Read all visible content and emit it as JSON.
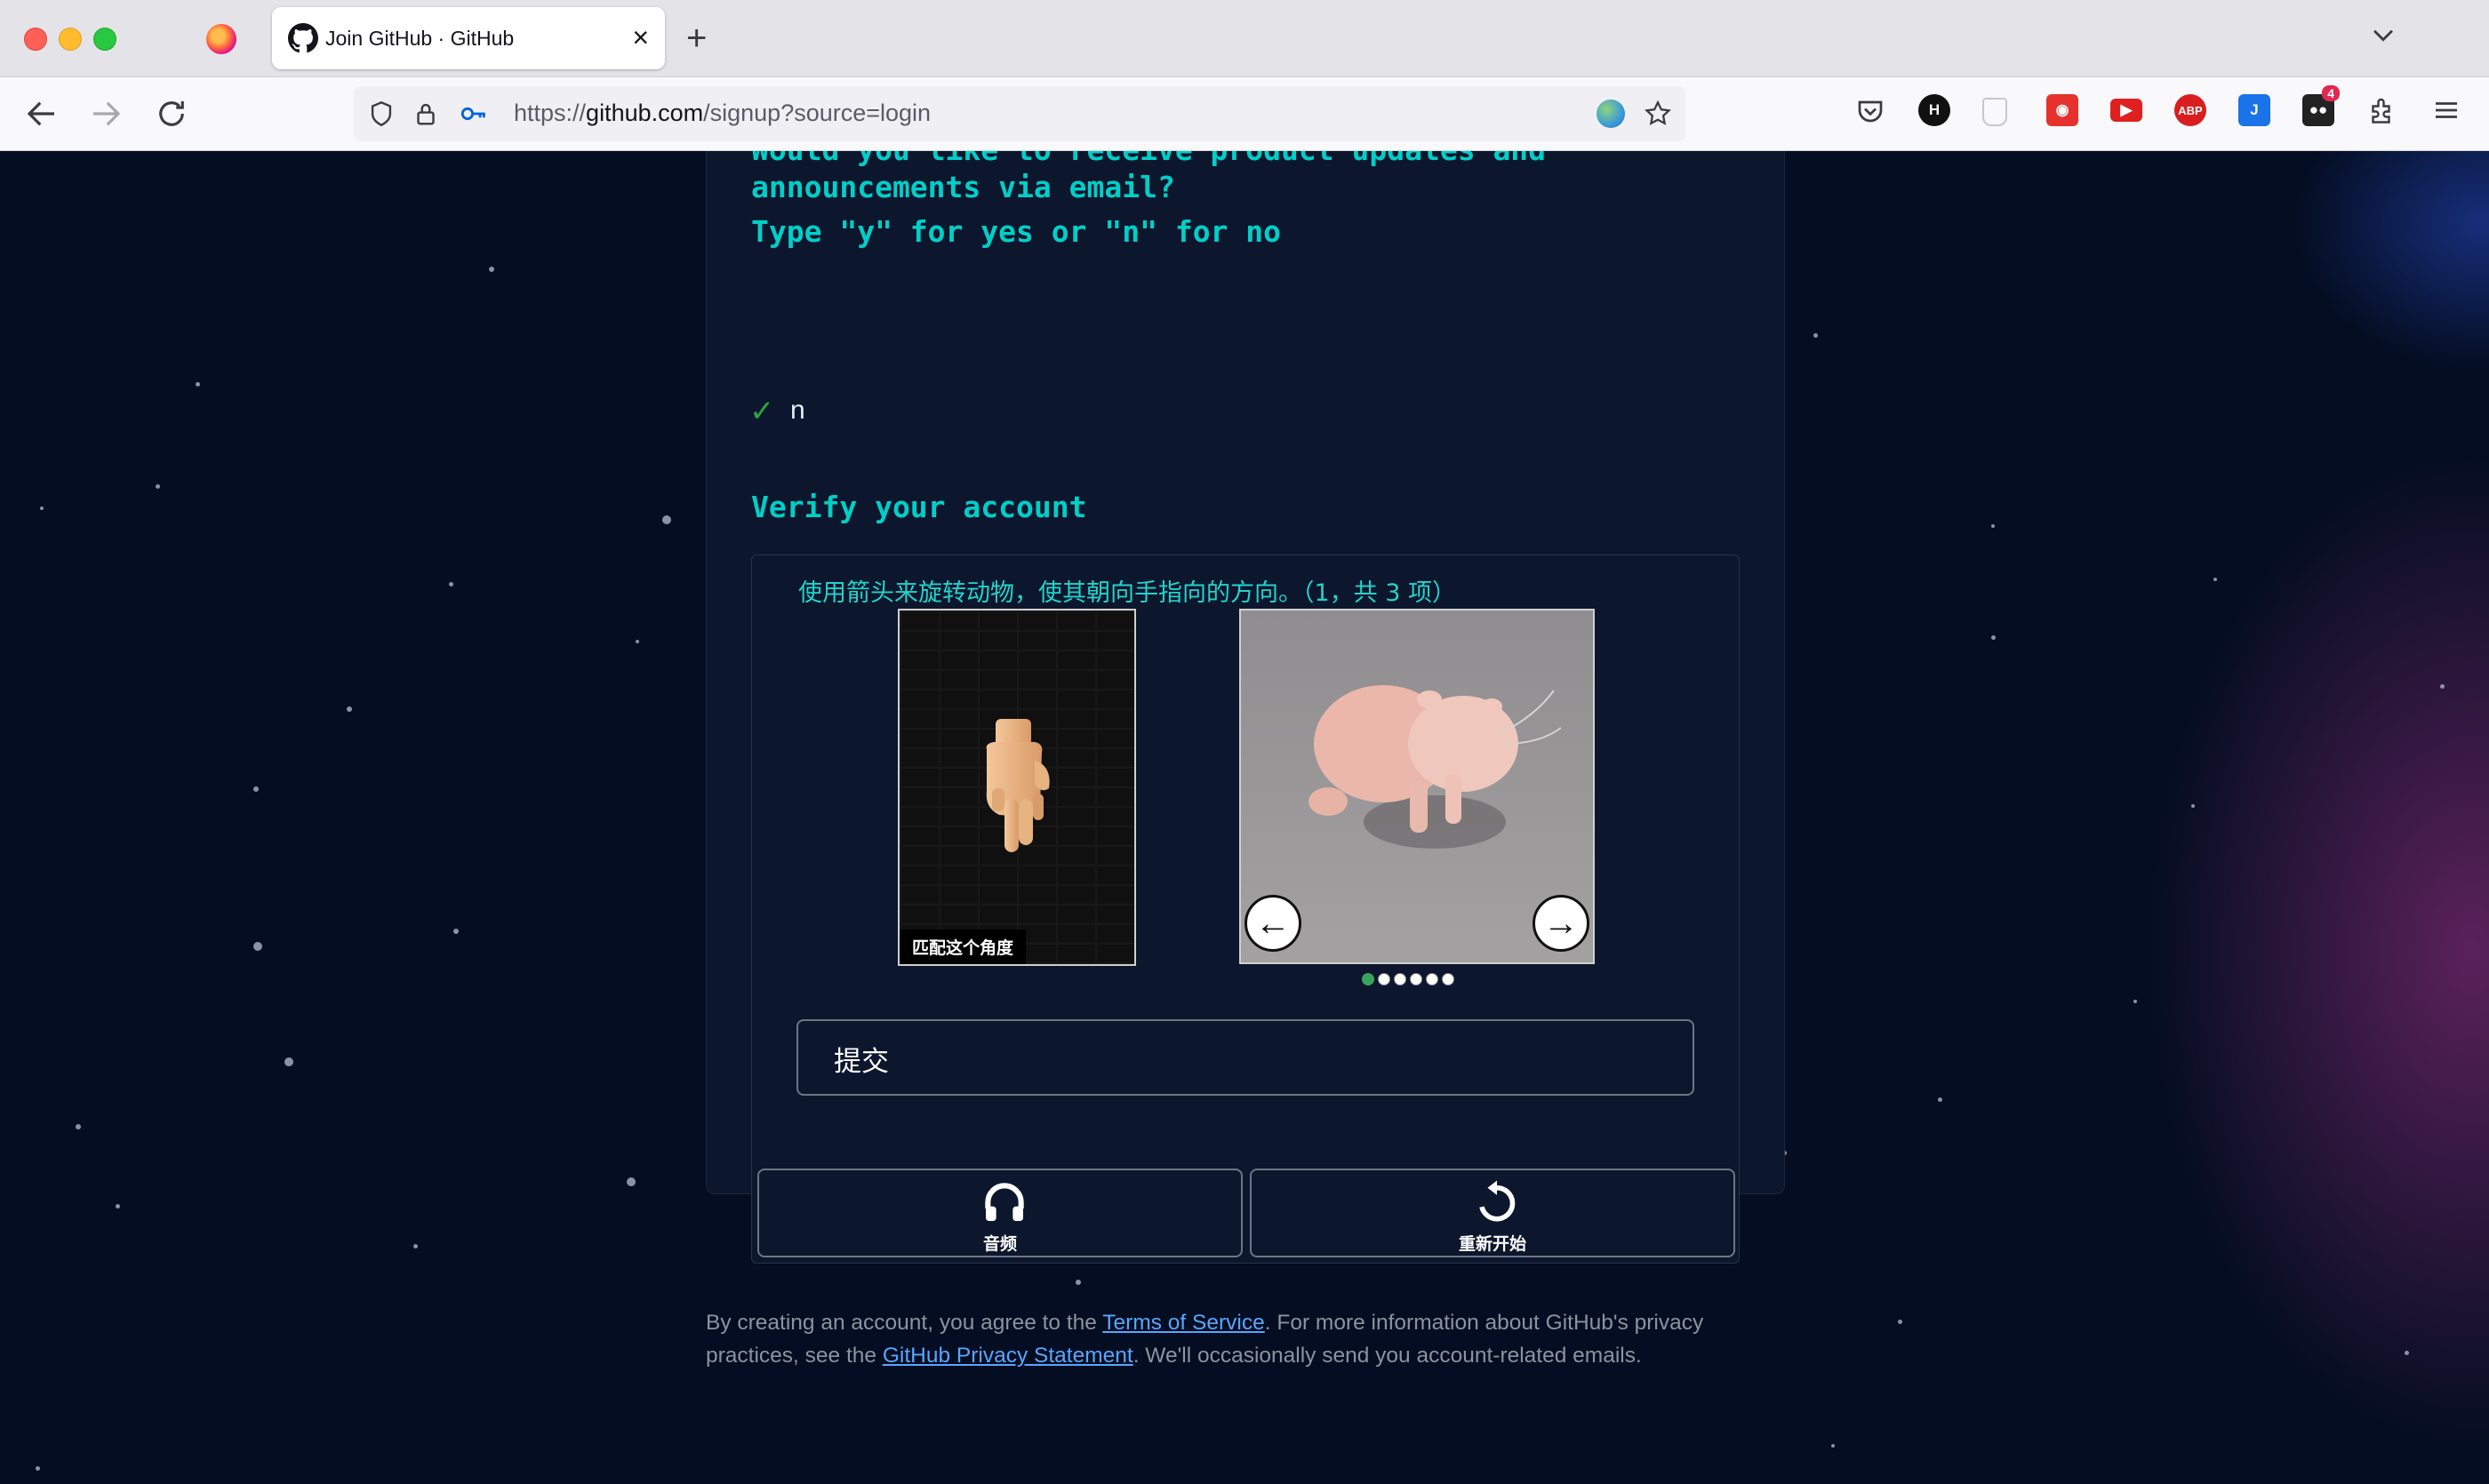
{
  "browser": {
    "tab_title": "Join GitHub · GitHub",
    "url_host": "github.com",
    "url_prefix": "https://",
    "url_path": "/signup?source=login",
    "extensions_badge": "4",
    "abp_label": "ABP",
    "h_label": "H"
  },
  "signup": {
    "question_line1": "Would you like to receive product updates and",
    "question_line2": "announcements via email?",
    "question_line3": "Type \"y\" for yes or \"n\" for no",
    "answer": "n",
    "verify_title": "Verify your account"
  },
  "captcha": {
    "instruction": "使用箭头来旋转动物，使其朝向手指向的方向。（1，共 3 项）",
    "match_label": "匹配这个角度",
    "submit_label": "提交",
    "audio_label": "音频",
    "restart_label": "重新开始",
    "current_step": 1,
    "total_dots": 6
  },
  "footer": {
    "text1": "By creating an account, you agree to the ",
    "terms_link": "Terms of Service",
    "text2": ". For more information about GitHub's privacy practices, see the ",
    "privacy_link": "GitHub Privacy Statement",
    "text3": ". We'll occasionally send you account-related emails."
  },
  "colors": {
    "accent": "#00cfc8",
    "link": "#58a6ff",
    "page_bg": "#040d21",
    "card_bg": "#0c162d"
  }
}
